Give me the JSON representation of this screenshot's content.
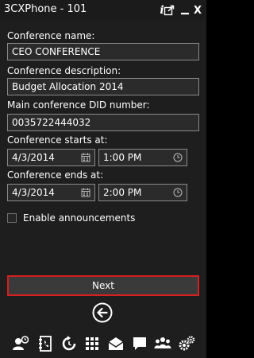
{
  "window": {
    "title": "3CXPhone - 101",
    "info_icon": "info-icon",
    "popout_icon": "popout-icon",
    "minimize_icon": "minimize-icon",
    "close_icon": "close-icon",
    "info_glyph": "i",
    "close_glyph": "X"
  },
  "form": {
    "name_label": "Conference name:",
    "name_value": "CEO CONFERENCE",
    "description_label": "Conference description:",
    "description_value": "Budget Allocation 2014",
    "did_label": "Main conference DID number:",
    "did_value": "0035722444032",
    "starts_label": "Conference starts at:",
    "starts_date": "4/3/2014",
    "starts_time": "1:00 PM",
    "ends_label": "Conference ends at:",
    "ends_date": "4/3/2014",
    "ends_time": "2:00 PM",
    "announcements_label": "Enable announcements",
    "announcements_checked": false
  },
  "actions": {
    "next_label": "Next",
    "back_icon": "back-arrow-icon"
  },
  "bottom_bar": {
    "icons": [
      "contacts-status-icon",
      "phonebook-icon",
      "call-history-icon",
      "dialpad-icon",
      "voicemail-icon",
      "chat-icon",
      "conference-icon",
      "settings-icon"
    ]
  },
  "colors": {
    "background": "#1e1e1e",
    "field_background": "#2b2b2b",
    "field_border": "#8a8a8a",
    "next_border": "#d42020"
  }
}
